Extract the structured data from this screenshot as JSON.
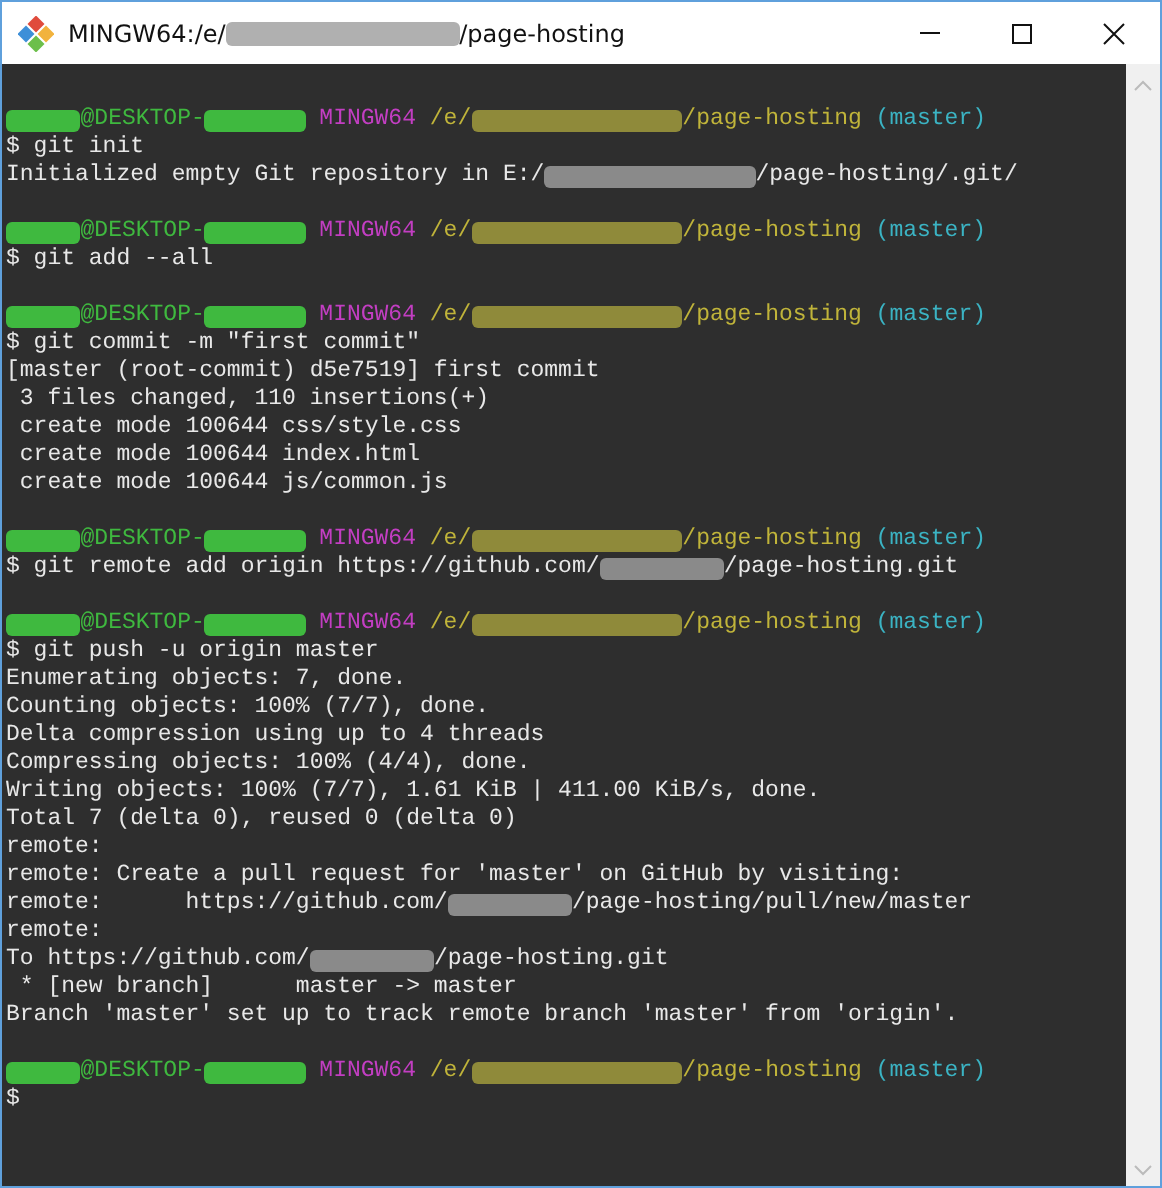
{
  "window": {
    "title": [
      {
        "kind": "text",
        "text": "MINGW64:/e/"
      },
      {
        "kind": "path"
      },
      {
        "kind": "text",
        "text": "/page-hosting"
      }
    ]
  },
  "terminal": {
    "lines": [
      {
        "kind": "blank"
      },
      {
        "kind": "line",
        "segments": [
          {
            "kind": "user",
            "color": "#3fb93f"
          },
          {
            "kind": "text",
            "text": "@DESKTOP-",
            "color": "#3fb93f"
          },
          {
            "kind": "host",
            "color": "#3fb93f"
          },
          {
            "kind": "text",
            "text": " MINGW64",
            "color": "#c23ec2"
          },
          {
            "kind": "text",
            "text": " /e/",
            "color": "#c0b43a"
          },
          {
            "kind": "path",
            "color": "#8f8a3a"
          },
          {
            "kind": "text",
            "text": "/page-hosting",
            "color": "#c0b43a"
          },
          {
            "kind": "text",
            "text": " (master)",
            "color": "#3bb3c3"
          }
        ]
      },
      {
        "kind": "line",
        "segments": [
          {
            "kind": "text",
            "text": "$ git init",
            "color": "#e8e8e8"
          }
        ]
      },
      {
        "kind": "line",
        "segments": [
          {
            "kind": "text",
            "text": "Initialized empty Git repository in E:/",
            "color": "#e8e8e8"
          },
          {
            "kind": "path",
            "color": "#8a8a8a"
          },
          {
            "kind": "text",
            "text": "/page-hosting/.git/",
            "color": "#e8e8e8"
          }
        ]
      },
      {
        "kind": "blank"
      },
      {
        "kind": "line",
        "segments": [
          {
            "kind": "user",
            "color": "#3fb93f"
          },
          {
            "kind": "text",
            "text": "@DESKTOP-",
            "color": "#3fb93f"
          },
          {
            "kind": "host",
            "color": "#3fb93f"
          },
          {
            "kind": "text",
            "text": " MINGW64",
            "color": "#c23ec2"
          },
          {
            "kind": "text",
            "text": " /e/",
            "color": "#c0b43a"
          },
          {
            "kind": "path",
            "color": "#8f8a3a"
          },
          {
            "kind": "text",
            "text": "/page-hosting",
            "color": "#c0b43a"
          },
          {
            "kind": "text",
            "text": " (master)",
            "color": "#3bb3c3"
          }
        ]
      },
      {
        "kind": "line",
        "segments": [
          {
            "kind": "text",
            "text": "$ git add --all",
            "color": "#e8e8e8"
          }
        ]
      },
      {
        "kind": "blank"
      },
      {
        "kind": "line",
        "segments": [
          {
            "kind": "user",
            "color": "#3fb93f"
          },
          {
            "kind": "text",
            "text": "@DESKTOP-",
            "color": "#3fb93f"
          },
          {
            "kind": "host",
            "color": "#3fb93f"
          },
          {
            "kind": "text",
            "text": " MINGW64",
            "color": "#c23ec2"
          },
          {
            "kind": "text",
            "text": " /e/",
            "color": "#c0b43a"
          },
          {
            "kind": "path",
            "color": "#8f8a3a"
          },
          {
            "kind": "text",
            "text": "/page-hosting",
            "color": "#c0b43a"
          },
          {
            "kind": "text",
            "text": " (master)",
            "color": "#3bb3c3"
          }
        ]
      },
      {
        "kind": "line",
        "segments": [
          {
            "kind": "text",
            "text": "$ git commit -m \"first commit\"",
            "color": "#e8e8e8"
          }
        ]
      },
      {
        "kind": "line",
        "segments": [
          {
            "kind": "text",
            "text": "[master (root-commit) d5e7519] first commit",
            "color": "#e8e8e8"
          }
        ]
      },
      {
        "kind": "line",
        "segments": [
          {
            "kind": "text",
            "text": " 3 files changed, 110 insertions(+)",
            "color": "#e8e8e8"
          }
        ]
      },
      {
        "kind": "line",
        "segments": [
          {
            "kind": "text",
            "text": " create mode 100644 css/style.css",
            "color": "#e8e8e8"
          }
        ]
      },
      {
        "kind": "line",
        "segments": [
          {
            "kind": "text",
            "text": " create mode 100644 index.html",
            "color": "#e8e8e8"
          }
        ]
      },
      {
        "kind": "line",
        "segments": [
          {
            "kind": "text",
            "text": " create mode 100644 js/common.js",
            "color": "#e8e8e8"
          }
        ]
      },
      {
        "kind": "blank"
      },
      {
        "kind": "line",
        "segments": [
          {
            "kind": "user",
            "color": "#3fb93f"
          },
          {
            "kind": "text",
            "text": "@DESKTOP-",
            "color": "#3fb93f"
          },
          {
            "kind": "host",
            "color": "#3fb93f"
          },
          {
            "kind": "text",
            "text": " MINGW64",
            "color": "#c23ec2"
          },
          {
            "kind": "text",
            "text": " /e/",
            "color": "#c0b43a"
          },
          {
            "kind": "path",
            "color": "#8f8a3a"
          },
          {
            "kind": "text",
            "text": "/page-hosting",
            "color": "#c0b43a"
          },
          {
            "kind": "text",
            "text": " (master)",
            "color": "#3bb3c3"
          }
        ]
      },
      {
        "kind": "line",
        "segments": [
          {
            "kind": "text",
            "text": "$ git remote add origin https://github.com/",
            "color": "#e8e8e8"
          },
          {
            "kind": "account",
            "color": "#8a8a8a"
          },
          {
            "kind": "text",
            "text": "/page-hosting.git",
            "color": "#e8e8e8"
          }
        ]
      },
      {
        "kind": "blank"
      },
      {
        "kind": "line",
        "segments": [
          {
            "kind": "user",
            "color": "#3fb93f"
          },
          {
            "kind": "text",
            "text": "@DESKTOP-",
            "color": "#3fb93f"
          },
          {
            "kind": "host",
            "color": "#3fb93f"
          },
          {
            "kind": "text",
            "text": " MINGW64",
            "color": "#c23ec2"
          },
          {
            "kind": "text",
            "text": " /e/",
            "color": "#c0b43a"
          },
          {
            "kind": "path",
            "color": "#8f8a3a"
          },
          {
            "kind": "text",
            "text": "/page-hosting",
            "color": "#c0b43a"
          },
          {
            "kind": "text",
            "text": " (master)",
            "color": "#3bb3c3"
          }
        ]
      },
      {
        "kind": "line",
        "segments": [
          {
            "kind": "text",
            "text": "$ git push -u origin master",
            "color": "#e8e8e8"
          }
        ]
      },
      {
        "kind": "line",
        "segments": [
          {
            "kind": "text",
            "text": "Enumerating objects: 7, done.",
            "color": "#e8e8e8"
          }
        ]
      },
      {
        "kind": "line",
        "segments": [
          {
            "kind": "text",
            "text": "Counting objects: 100% (7/7), done.",
            "color": "#e8e8e8"
          }
        ]
      },
      {
        "kind": "line",
        "segments": [
          {
            "kind": "text",
            "text": "Delta compression using up to 4 threads",
            "color": "#e8e8e8"
          }
        ]
      },
      {
        "kind": "line",
        "segments": [
          {
            "kind": "text",
            "text": "Compressing objects: 100% (4/4), done.",
            "color": "#e8e8e8"
          }
        ]
      },
      {
        "kind": "line",
        "segments": [
          {
            "kind": "text",
            "text": "Writing objects: 100% (7/7), 1.61 KiB | 411.00 KiB/s, done.",
            "color": "#e8e8e8"
          }
        ]
      },
      {
        "kind": "line",
        "segments": [
          {
            "kind": "text",
            "text": "Total 7 (delta 0), reused 0 (delta 0)",
            "color": "#e8e8e8"
          }
        ]
      },
      {
        "kind": "line",
        "segments": [
          {
            "kind": "text",
            "text": "remote:",
            "color": "#e8e8e8"
          }
        ]
      },
      {
        "kind": "line",
        "segments": [
          {
            "kind": "text",
            "text": "remote: Create a pull request for 'master' on GitHub by visiting:",
            "color": "#e8e8e8"
          }
        ]
      },
      {
        "kind": "line",
        "segments": [
          {
            "kind": "text",
            "text": "remote:      https://github.com/",
            "color": "#e8e8e8"
          },
          {
            "kind": "account",
            "color": "#8a8a8a"
          },
          {
            "kind": "text",
            "text": "/page-hosting/pull/new/master",
            "color": "#e8e8e8"
          }
        ]
      },
      {
        "kind": "line",
        "segments": [
          {
            "kind": "text",
            "text": "remote:",
            "color": "#e8e8e8"
          }
        ]
      },
      {
        "kind": "line",
        "segments": [
          {
            "kind": "text",
            "text": "To https://github.com/",
            "color": "#e8e8e8"
          },
          {
            "kind": "account",
            "color": "#8a8a8a"
          },
          {
            "kind": "text",
            "text": "/page-hosting.git",
            "color": "#e8e8e8"
          }
        ]
      },
      {
        "kind": "line",
        "segments": [
          {
            "kind": "text",
            "text": " * [new branch]      master -> master",
            "color": "#e8e8e8"
          }
        ]
      },
      {
        "kind": "line",
        "segments": [
          {
            "kind": "text",
            "text": "Branch 'master' set up to track remote branch 'master' from 'origin'.",
            "color": "#e8e8e8"
          }
        ]
      },
      {
        "kind": "blank"
      },
      {
        "kind": "line",
        "segments": [
          {
            "kind": "user",
            "color": "#3fb93f"
          },
          {
            "kind": "text",
            "text": "@DESKTOP-",
            "color": "#3fb93f"
          },
          {
            "kind": "host",
            "color": "#3fb93f"
          },
          {
            "kind": "text",
            "text": " MINGW64",
            "color": "#c23ec2"
          },
          {
            "kind": "text",
            "text": " /e/",
            "color": "#c0b43a"
          },
          {
            "kind": "path",
            "color": "#8f8a3a"
          },
          {
            "kind": "text",
            "text": "/page-hosting",
            "color": "#c0b43a"
          },
          {
            "kind": "text",
            "text": " (master)",
            "color": "#3bb3c3"
          }
        ]
      },
      {
        "kind": "line",
        "segments": [
          {
            "kind": "text",
            "text": "$",
            "color": "#e8e8e8"
          }
        ]
      }
    ]
  }
}
